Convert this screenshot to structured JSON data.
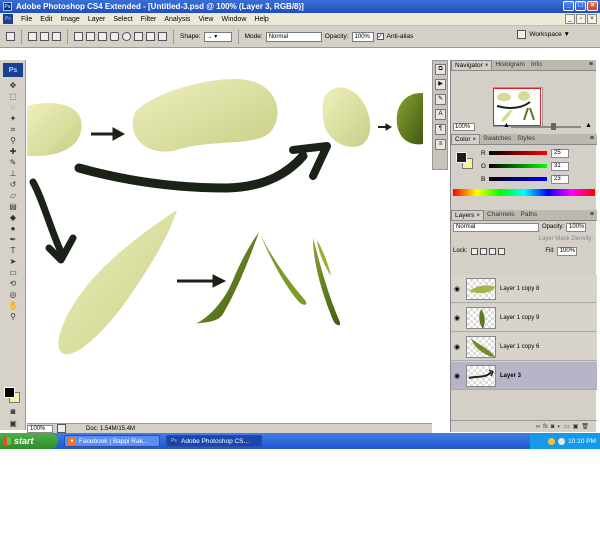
{
  "window": {
    "title": "Adobe Photoshop CS4 Extended - [Untitled-3.psd @ 100% (Layer 3, RGB/8)]"
  },
  "menu": [
    "File",
    "Edit",
    "Image",
    "Layer",
    "Select",
    "Filter",
    "Analysis",
    "View",
    "Window",
    "Help"
  ],
  "options": {
    "shape_label": "Shape:",
    "mode_label": "Mode:",
    "mode_value": "Normal",
    "opacity_label": "Opacity:",
    "opacity_value": "100%",
    "antialias_label": "Anti-alias",
    "workspace_label": "Workspace ▼"
  },
  "tools": {
    "logo": "Ps"
  },
  "status": {
    "zoom": "100%",
    "doc": "Doc: 1.54M/15.4M"
  },
  "navigator": {
    "tabs": [
      "Navigator",
      "Histogram",
      "Info"
    ],
    "zoom": "100%"
  },
  "color": {
    "tabs": [
      "Color",
      "Swatches",
      "Styles"
    ],
    "channels": [
      {
        "label": "R",
        "value": "25"
      },
      {
        "label": "G",
        "value": "31"
      },
      {
        "label": "B",
        "value": "23"
      }
    ],
    "fg": "#1f1f17",
    "bg": "#f9f39a"
  },
  "layers": {
    "tabs": [
      "Layers",
      "Channels",
      "Paths"
    ],
    "blend": "Normal",
    "opacity_label": "Opacity:",
    "opacity_value": "100%",
    "mask_label": "Layer Mask Density:",
    "lock_label": "Lock:",
    "fill_label": "Fill:",
    "fill_value": "100%",
    "items": [
      {
        "name": "Layer 1 copy 8"
      },
      {
        "name": "Layer 1 copy 9"
      },
      {
        "name": "Layer 1 copy 6"
      },
      {
        "name": "Layer 3"
      }
    ]
  },
  "taskbar": {
    "start": "start",
    "tasks": [
      {
        "label": "Facebook | Bappi Rak..."
      },
      {
        "label": "Adobe Photoshop CS..."
      }
    ],
    "clock": "10:10 PM"
  },
  "colors": {
    "leaf_light": "#dfe3a4",
    "leaf_dark": "#51701c",
    "stroke": "#1b2218",
    "xp_blue": "#2257cf"
  }
}
